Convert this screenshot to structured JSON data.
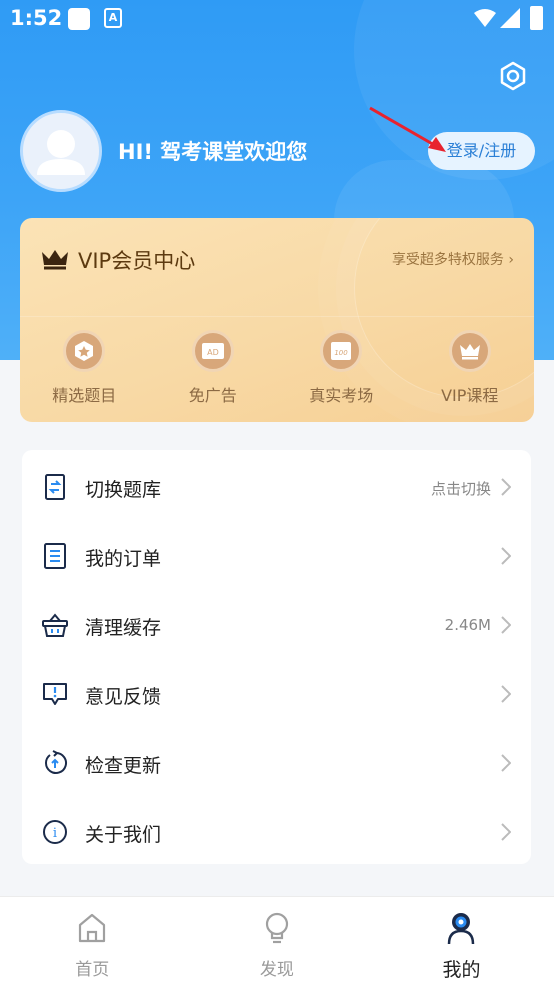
{
  "status_bar": {
    "time": "1:52",
    "app_icon_letter": "A"
  },
  "header": {
    "greeting": "HI! 驾考课堂欢迎您",
    "login_label": "登录/注册"
  },
  "vip": {
    "title": "VIP会员中心",
    "more_label": "享受超多特权服务",
    "benefits": [
      {
        "label": "精选题目",
        "icon": "star-badge-icon"
      },
      {
        "label": "免广告",
        "icon": "ad-icon",
        "icon_text": "AD"
      },
      {
        "label": "真实考场",
        "icon": "exam-paper-icon",
        "icon_text": "100"
      },
      {
        "label": "VIP课程",
        "icon": "crown-icon"
      }
    ]
  },
  "menu": {
    "items": [
      {
        "label": "切换题库",
        "value": "点击切换",
        "icon": "switch-bank-icon"
      },
      {
        "label": "我的订单",
        "value": "",
        "icon": "order-icon"
      },
      {
        "label": "清理缓存",
        "value": "2.46M",
        "icon": "basket-icon"
      },
      {
        "label": "意见反馈",
        "value": "",
        "icon": "feedback-icon"
      },
      {
        "label": "检查更新",
        "value": "",
        "icon": "update-icon"
      },
      {
        "label": "关于我们",
        "value": "",
        "icon": "info-icon",
        "icon_text": "i"
      }
    ]
  },
  "tabbar": {
    "tabs": [
      {
        "label": "首页",
        "active": false
      },
      {
        "label": "发现",
        "active": false
      },
      {
        "label": "我的",
        "active": true
      }
    ]
  },
  "colors": {
    "header_blue": "#2f9bf5",
    "vip_gold": "#f8d9a5",
    "accent_red": "#e8232e"
  }
}
